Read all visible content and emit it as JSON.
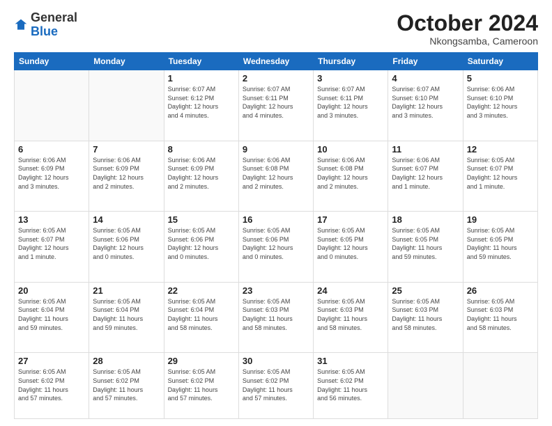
{
  "header": {
    "logo_general": "General",
    "logo_blue": "Blue",
    "month_title": "October 2024",
    "location": "Nkongsamba, Cameroon"
  },
  "days_of_week": [
    "Sunday",
    "Monday",
    "Tuesday",
    "Wednesday",
    "Thursday",
    "Friday",
    "Saturday"
  ],
  "weeks": [
    [
      {
        "day": "",
        "info": ""
      },
      {
        "day": "",
        "info": ""
      },
      {
        "day": "1",
        "info": "Sunrise: 6:07 AM\nSunset: 6:12 PM\nDaylight: 12 hours\nand 4 minutes."
      },
      {
        "day": "2",
        "info": "Sunrise: 6:07 AM\nSunset: 6:11 PM\nDaylight: 12 hours\nand 4 minutes."
      },
      {
        "day": "3",
        "info": "Sunrise: 6:07 AM\nSunset: 6:11 PM\nDaylight: 12 hours\nand 3 minutes."
      },
      {
        "day": "4",
        "info": "Sunrise: 6:07 AM\nSunset: 6:10 PM\nDaylight: 12 hours\nand 3 minutes."
      },
      {
        "day": "5",
        "info": "Sunrise: 6:06 AM\nSunset: 6:10 PM\nDaylight: 12 hours\nand 3 minutes."
      }
    ],
    [
      {
        "day": "6",
        "info": "Sunrise: 6:06 AM\nSunset: 6:09 PM\nDaylight: 12 hours\nand 3 minutes."
      },
      {
        "day": "7",
        "info": "Sunrise: 6:06 AM\nSunset: 6:09 PM\nDaylight: 12 hours\nand 2 minutes."
      },
      {
        "day": "8",
        "info": "Sunrise: 6:06 AM\nSunset: 6:09 PM\nDaylight: 12 hours\nand 2 minutes."
      },
      {
        "day": "9",
        "info": "Sunrise: 6:06 AM\nSunset: 6:08 PM\nDaylight: 12 hours\nand 2 minutes."
      },
      {
        "day": "10",
        "info": "Sunrise: 6:06 AM\nSunset: 6:08 PM\nDaylight: 12 hours\nand 2 minutes."
      },
      {
        "day": "11",
        "info": "Sunrise: 6:06 AM\nSunset: 6:07 PM\nDaylight: 12 hours\nand 1 minute."
      },
      {
        "day": "12",
        "info": "Sunrise: 6:05 AM\nSunset: 6:07 PM\nDaylight: 12 hours\nand 1 minute."
      }
    ],
    [
      {
        "day": "13",
        "info": "Sunrise: 6:05 AM\nSunset: 6:07 PM\nDaylight: 12 hours\nand 1 minute."
      },
      {
        "day": "14",
        "info": "Sunrise: 6:05 AM\nSunset: 6:06 PM\nDaylight: 12 hours\nand 0 minutes."
      },
      {
        "day": "15",
        "info": "Sunrise: 6:05 AM\nSunset: 6:06 PM\nDaylight: 12 hours\nand 0 minutes."
      },
      {
        "day": "16",
        "info": "Sunrise: 6:05 AM\nSunset: 6:06 PM\nDaylight: 12 hours\nand 0 minutes."
      },
      {
        "day": "17",
        "info": "Sunrise: 6:05 AM\nSunset: 6:05 PM\nDaylight: 12 hours\nand 0 minutes."
      },
      {
        "day": "18",
        "info": "Sunrise: 6:05 AM\nSunset: 6:05 PM\nDaylight: 11 hours\nand 59 minutes."
      },
      {
        "day": "19",
        "info": "Sunrise: 6:05 AM\nSunset: 6:05 PM\nDaylight: 11 hours\nand 59 minutes."
      }
    ],
    [
      {
        "day": "20",
        "info": "Sunrise: 6:05 AM\nSunset: 6:04 PM\nDaylight: 11 hours\nand 59 minutes."
      },
      {
        "day": "21",
        "info": "Sunrise: 6:05 AM\nSunset: 6:04 PM\nDaylight: 11 hours\nand 59 minutes."
      },
      {
        "day": "22",
        "info": "Sunrise: 6:05 AM\nSunset: 6:04 PM\nDaylight: 11 hours\nand 58 minutes."
      },
      {
        "day": "23",
        "info": "Sunrise: 6:05 AM\nSunset: 6:03 PM\nDaylight: 11 hours\nand 58 minutes."
      },
      {
        "day": "24",
        "info": "Sunrise: 6:05 AM\nSunset: 6:03 PM\nDaylight: 11 hours\nand 58 minutes."
      },
      {
        "day": "25",
        "info": "Sunrise: 6:05 AM\nSunset: 6:03 PM\nDaylight: 11 hours\nand 58 minutes."
      },
      {
        "day": "26",
        "info": "Sunrise: 6:05 AM\nSunset: 6:03 PM\nDaylight: 11 hours\nand 58 minutes."
      }
    ],
    [
      {
        "day": "27",
        "info": "Sunrise: 6:05 AM\nSunset: 6:02 PM\nDaylight: 11 hours\nand 57 minutes."
      },
      {
        "day": "28",
        "info": "Sunrise: 6:05 AM\nSunset: 6:02 PM\nDaylight: 11 hours\nand 57 minutes."
      },
      {
        "day": "29",
        "info": "Sunrise: 6:05 AM\nSunset: 6:02 PM\nDaylight: 11 hours\nand 57 minutes."
      },
      {
        "day": "30",
        "info": "Sunrise: 6:05 AM\nSunset: 6:02 PM\nDaylight: 11 hours\nand 57 minutes."
      },
      {
        "day": "31",
        "info": "Sunrise: 6:05 AM\nSunset: 6:02 PM\nDaylight: 11 hours\nand 56 minutes."
      },
      {
        "day": "",
        "info": ""
      },
      {
        "day": "",
        "info": ""
      }
    ]
  ]
}
